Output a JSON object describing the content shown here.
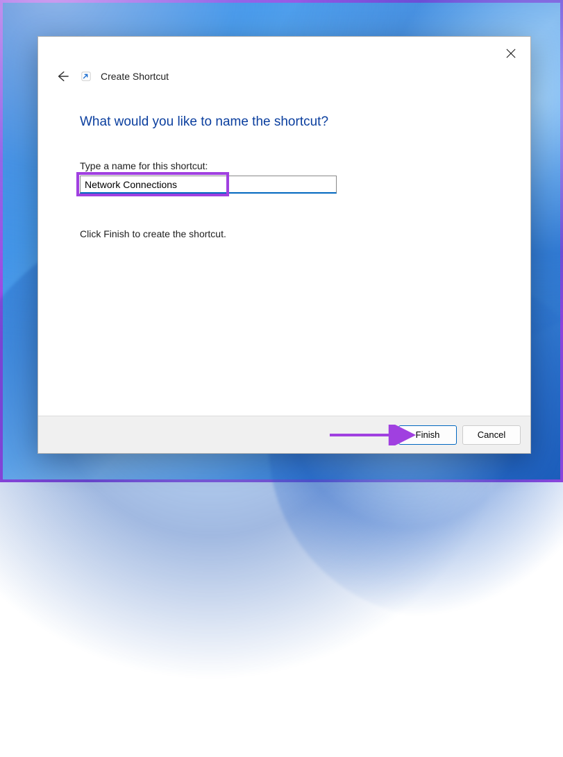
{
  "dialog": {
    "window_title": "Create Shortcut",
    "heading": "What would you like to name the shortcut?",
    "field_label": "Type a name for this shortcut:",
    "input_value": "Network Connections",
    "hint": "Click Finish to create the shortcut.",
    "buttons": {
      "finish": "Finish",
      "cancel": "Cancel"
    }
  },
  "annotation": {
    "highlight_color": "#a040e0"
  }
}
